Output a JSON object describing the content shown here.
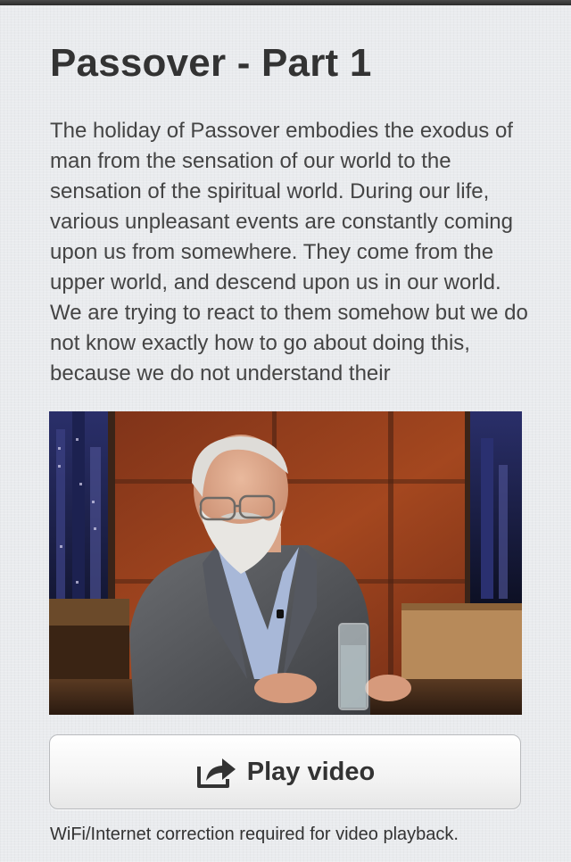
{
  "article": {
    "title": "Passover - Part 1",
    "description": "The holiday of Passover embodies the exodus of man from the sensation of our world to the sensation of the spiritual world. During our life, various unpleasant events are constantly coming upon us from somewhere. They come from the upper world, and descend upon us in our world. We are trying to react to them somehow but we do not know exactly how to go about doing this, because we do not understand their"
  },
  "video": {
    "thumbnail_icon": "video-thumbnail",
    "play_label": "Play video",
    "play_icon": "share-arrow-icon",
    "note": "WiFi/Internet correction required for video playback."
  },
  "colors": {
    "background": "#e9ebee",
    "title_text": "#333333",
    "body_text": "#444444",
    "button_text": "#333333"
  }
}
